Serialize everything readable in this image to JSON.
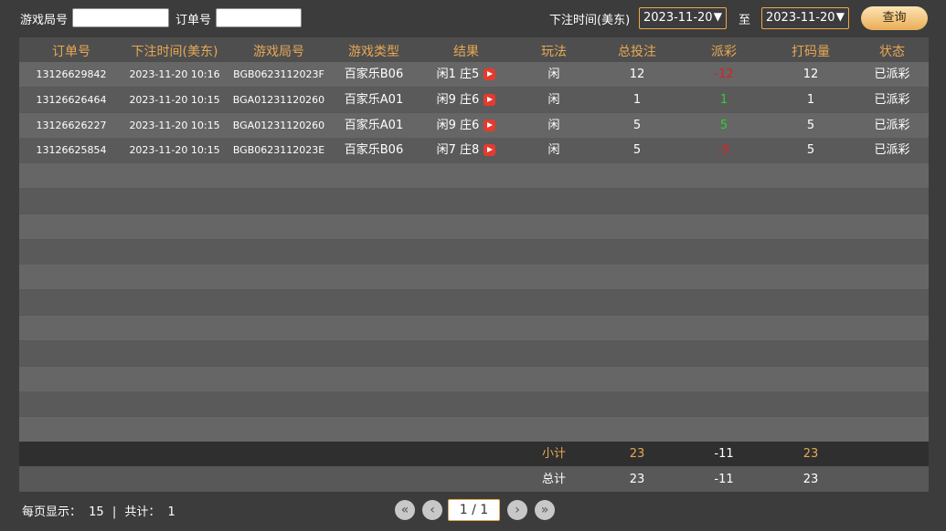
{
  "filters": {
    "game_id_label": "游戏局号",
    "order_no_label": "订单号",
    "bet_time_label": "下注时间(美东)",
    "date_from": "2023-11-20",
    "to_label": "至",
    "date_to": "2023-11-20",
    "query_label": "查询"
  },
  "table": {
    "headers": [
      "订单号",
      "下注时间(美东)",
      "游戏局号",
      "游戏类型",
      "结果",
      "玩法",
      "总投注",
      "派彩",
      "打码量",
      "状态"
    ],
    "rows": [
      {
        "order": "13126629842",
        "time": "2023-11-20 10:16",
        "game_id": "BGB0623112023F",
        "game_type": "百家乐B06",
        "result": "闲1 庄5",
        "play": "闲",
        "bet": "12",
        "payout": "-12",
        "payout_color": "red",
        "turnover": "12",
        "status": "已派彩"
      },
      {
        "order": "13126626464",
        "time": "2023-11-20 10:15",
        "game_id": "BGA01231120260",
        "game_type": "百家乐A01",
        "result": "闲9 庄6",
        "play": "闲",
        "bet": "1",
        "payout": "1",
        "payout_color": "green",
        "turnover": "1",
        "status": "已派彩"
      },
      {
        "order": "13126626227",
        "time": "2023-11-20 10:15",
        "game_id": "BGA01231120260",
        "game_type": "百家乐A01",
        "result": "闲9 庄6",
        "play": "闲",
        "bet": "5",
        "payout": "5",
        "payout_color": "green",
        "turnover": "5",
        "status": "已派彩"
      },
      {
        "order": "13126625854",
        "time": "2023-11-20 10:15",
        "game_id": "BGB0623112023E",
        "game_type": "百家乐B06",
        "result": "闲7 庄8",
        "play": "闲",
        "bet": "5",
        "payout": "-5",
        "payout_color": "red",
        "turnover": "5",
        "status": "已派彩"
      }
    ],
    "subtotal": {
      "label": "小计",
      "bet": "23",
      "payout": "-11",
      "turnover": "23"
    },
    "total": {
      "label": "总计",
      "bet": "23",
      "payout": "-11",
      "turnover": "23"
    }
  },
  "pager": {
    "per_page_label": "每页显示：",
    "per_page": "15",
    "separator": "|",
    "total_label": "共计：",
    "total": "1",
    "current_page": "1 / 1"
  },
  "colors": {
    "header_text": "#e7a853",
    "negative": "#e01e1e",
    "positive": "#30d030"
  },
  "icons": {
    "play": "play-video-icon",
    "first": "first-page-icon",
    "prev": "prev-page-icon",
    "next": "next-page-icon",
    "last": "last-page-icon"
  }
}
